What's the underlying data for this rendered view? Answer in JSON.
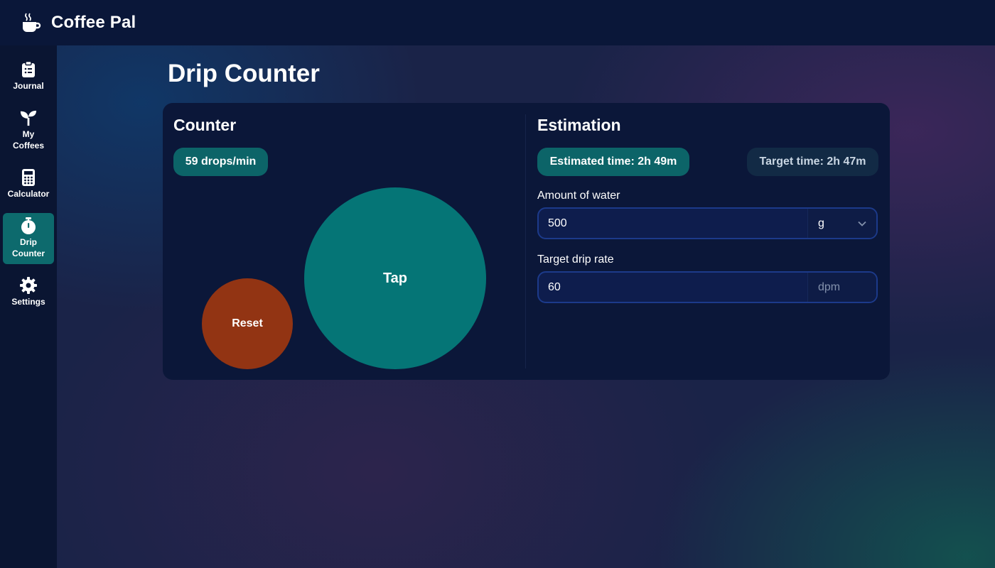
{
  "app": {
    "title": "Coffee Pal",
    "logo_icon": "coffee-cup-icon"
  },
  "sidebar": {
    "items": [
      {
        "label": "Journal",
        "icon": "clipboard-list-icon",
        "active": false
      },
      {
        "label": "My\nCoffees",
        "icon": "seedling-icon",
        "active": false
      },
      {
        "label": "Calculator",
        "icon": "calculator-icon",
        "active": false
      },
      {
        "label": "Drip\nCounter",
        "icon": "stopwatch-icon",
        "active": true
      },
      {
        "label": "Settings",
        "icon": "gear-icon",
        "active": false
      }
    ]
  },
  "page": {
    "title": "Drip Counter"
  },
  "counter": {
    "title": "Counter",
    "rate_badge": "59 drops/min",
    "tap_label": "Tap",
    "reset_label": "Reset"
  },
  "estimation": {
    "title": "Estimation",
    "estimated_time": "Estimated time: 2h 49m",
    "target_time": "Target time: 2h 47m",
    "water": {
      "label": "Amount of water",
      "value": "500",
      "unit": "g"
    },
    "drip_rate": {
      "label": "Target drip rate",
      "value": "60",
      "unit": "dpm"
    }
  },
  "colors": {
    "accent_teal": "#057576",
    "reset_orange": "#923413",
    "active_nav": "#0d6a6d",
    "card_bg": "#0b1739"
  }
}
